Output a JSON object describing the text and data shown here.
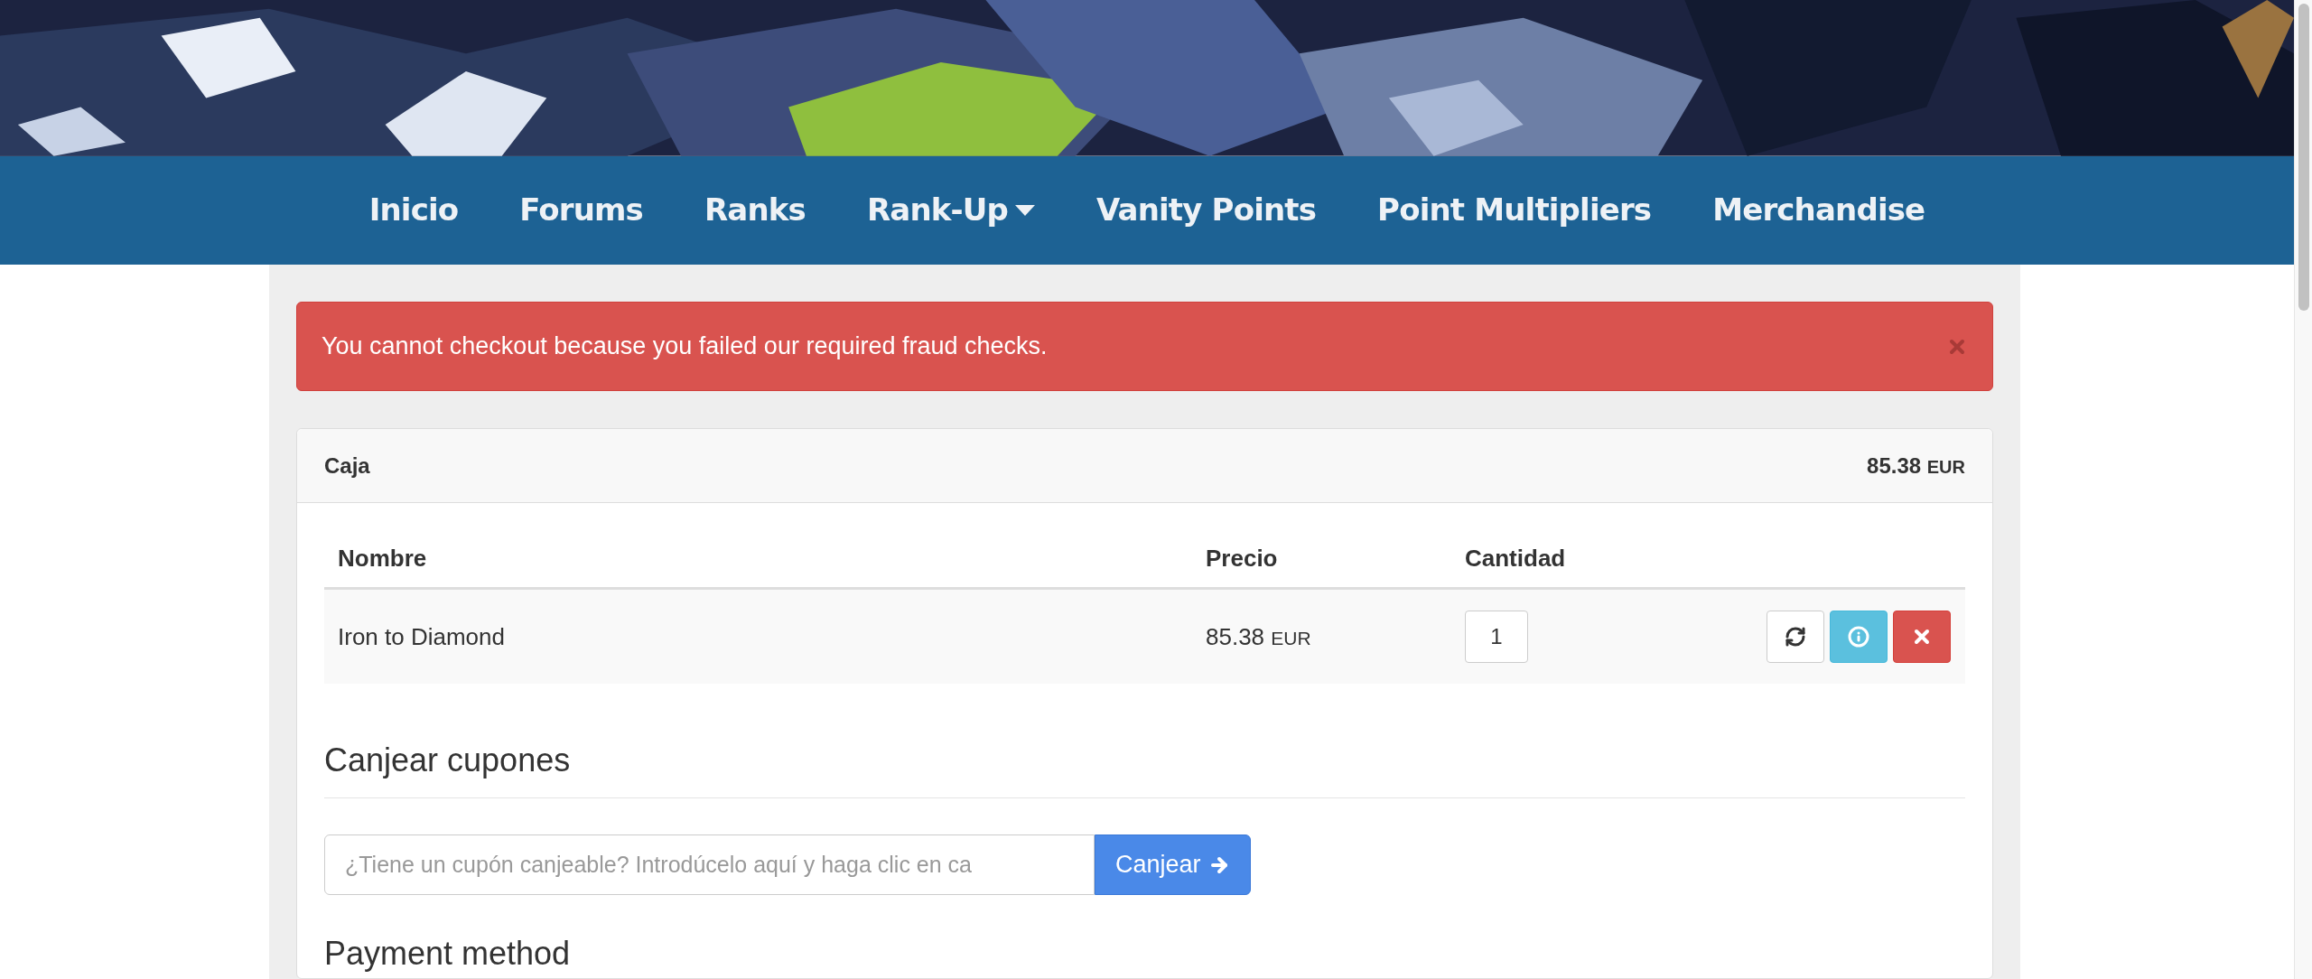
{
  "nav": {
    "items": [
      {
        "label": "Inicio",
        "dropdown": false
      },
      {
        "label": "Forums",
        "dropdown": false
      },
      {
        "label": "Ranks",
        "dropdown": false
      },
      {
        "label": "Rank-Up",
        "dropdown": true
      },
      {
        "label": "Vanity Points",
        "dropdown": false
      },
      {
        "label": "Point Multipliers",
        "dropdown": false
      },
      {
        "label": "Merchandise",
        "dropdown": false
      }
    ]
  },
  "alert": {
    "message": "You cannot checkout because you failed our required fraud checks."
  },
  "panel": {
    "title": "Caja",
    "total": "85.38",
    "currency": "EUR",
    "columns": [
      "Nombre",
      "Precio",
      "Cantidad"
    ],
    "rows": [
      {
        "name": "Iron to Diamond",
        "price": "85.38",
        "currency": "EUR",
        "quantity": "1"
      }
    ]
  },
  "coupon": {
    "heading": "Canjear cupones",
    "placeholder": "¿Tiene un cupón canjeable? Introdúcelo aquí y haga clic en ca",
    "button": "Canjear"
  },
  "payment": {
    "heading": "Payment method"
  }
}
